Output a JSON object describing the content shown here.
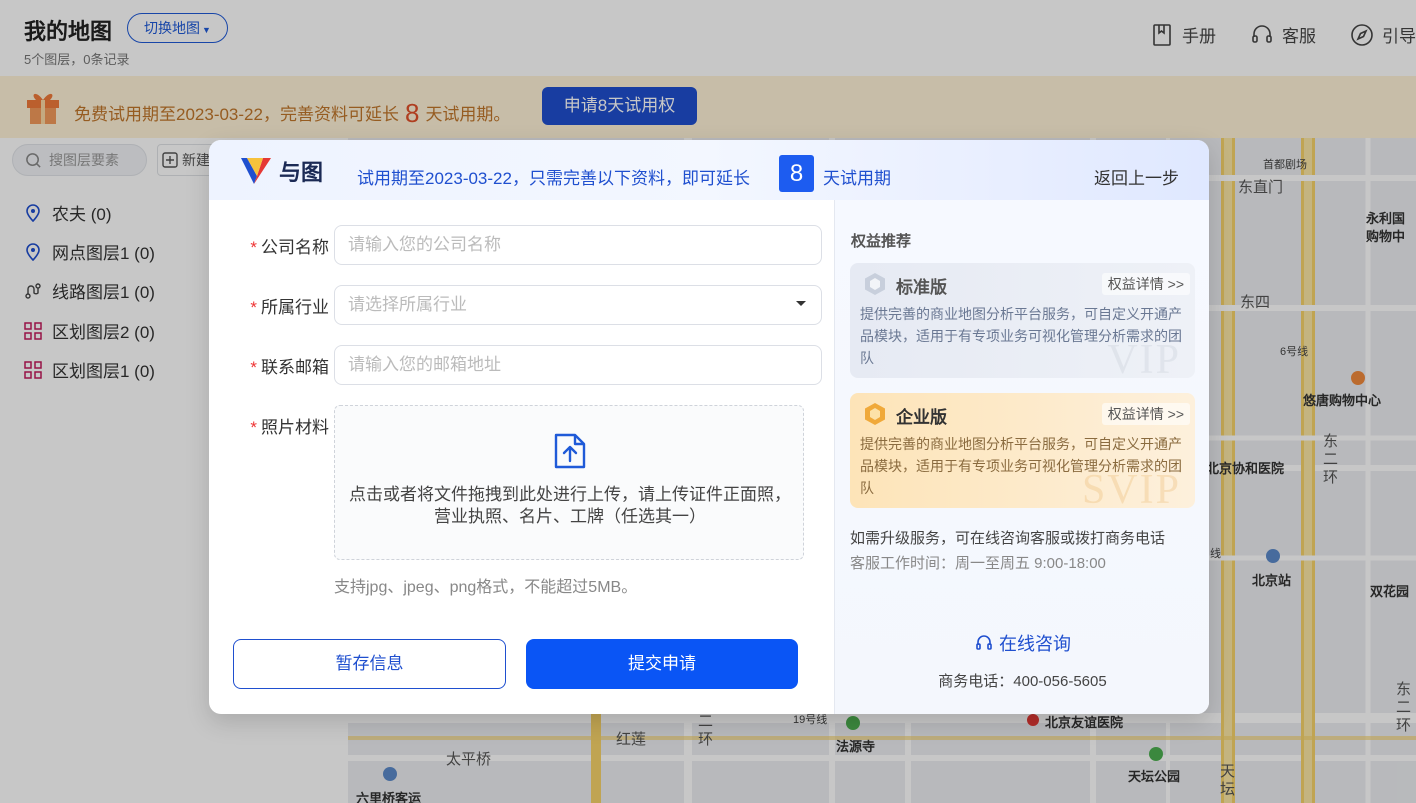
{
  "page": {
    "title": "我的地图",
    "switch_label": "切换地图",
    "subtitle": "5个图层，0条记录",
    "actions": [
      {
        "label": "手册",
        "icon": "book-icon"
      },
      {
        "label": "客服",
        "icon": "headset-icon"
      },
      {
        "label": "引导",
        "icon": "compass-icon"
      }
    ]
  },
  "promo": {
    "text_before": "免费试用期至2023-03-22，完善资料可延长",
    "days": "8",
    "text_after": "天试用期。",
    "button": "申请8天试用权"
  },
  "sidebar": {
    "search_placeholder": "搜图层要素",
    "new_label": "新建",
    "layers": [
      {
        "label": "农夫 (0)",
        "icon": "pin-icon"
      },
      {
        "label": "网点图层1 (0)",
        "icon": "pin-icon"
      },
      {
        "label": "线路图层1 (0)",
        "icon": "route-icon"
      },
      {
        "label": "区划图层2 (0)",
        "icon": "region-icon"
      },
      {
        "label": "区划图层1 (0)",
        "icon": "region-icon"
      }
    ]
  },
  "map": {
    "labels": [
      "东直门",
      "永利国",
      "购物中",
      "东四",
      "6号线",
      "悠唐购物中心",
      "东",
      "二",
      "环",
      "北京协和医院",
      "北京站",
      "双花园",
      "北京友谊医院",
      "法源寺",
      "红莲",
      "二",
      "环",
      "太平桥",
      "六里桥客运",
      "天坛公园",
      "天",
      "坛",
      "东",
      "二",
      "环",
      "首都剧场",
      "19号线",
      "线"
    ]
  },
  "dialog": {
    "brand": "与图",
    "header_text": "试用期至2023-03-22，只需完善以下资料，即可延长",
    "days": "8",
    "header_text2": "天试用期",
    "back": "返回上一步",
    "fields": {
      "company": {
        "label": "公司名称",
        "placeholder": "请输入您的公司名称"
      },
      "industry": {
        "label": "所属行业",
        "placeholder": "请选择所属行业"
      },
      "email": {
        "label": "联系邮箱",
        "placeholder": "请输入您的邮箱地址"
      },
      "photo": {
        "label": "照片材料"
      }
    },
    "upload_text_1": "点击或者将文件拖拽到此处进行上传，请上传证件正面照，",
    "upload_text_2": "营业执照、名片、工牌（任选其一）",
    "upload_hint": "支持jpg、jpeg、png格式，不能超过5MB。",
    "save_button": "暂存信息",
    "submit_button": "提交申请",
    "right": {
      "title": "权益推荐",
      "cards": [
        {
          "title": "标准版",
          "link": "权益详情 >>",
          "desc": "提供完善的商业地图分析平台服务，可自定义开通产品模块，适用于有专项业务可视化管理分析需求的团队",
          "watermark": "VIP"
        },
        {
          "title": "企业版",
          "link": "权益详情 >>",
          "desc": "提供完善的商业地图分析平台服务，可自定义开通产品模块，适用于有专项业务可视化管理分析需求的团队",
          "watermark": "SVIP"
        }
      ],
      "text1": "如需升级服务，可在线咨询客服或拨打商务电话",
      "text2": "客服工作时间：周一至周五 9:00-18:00",
      "consult": "在线咨询",
      "phone": "商务电话：400-056-5605"
    }
  },
  "colors": {
    "primary": "#0a55f5",
    "brand_blue": "#1f4fcf",
    "promo_bg": "#fff2d8",
    "promo_text": "#c0762b",
    "required": "#e33333"
  }
}
